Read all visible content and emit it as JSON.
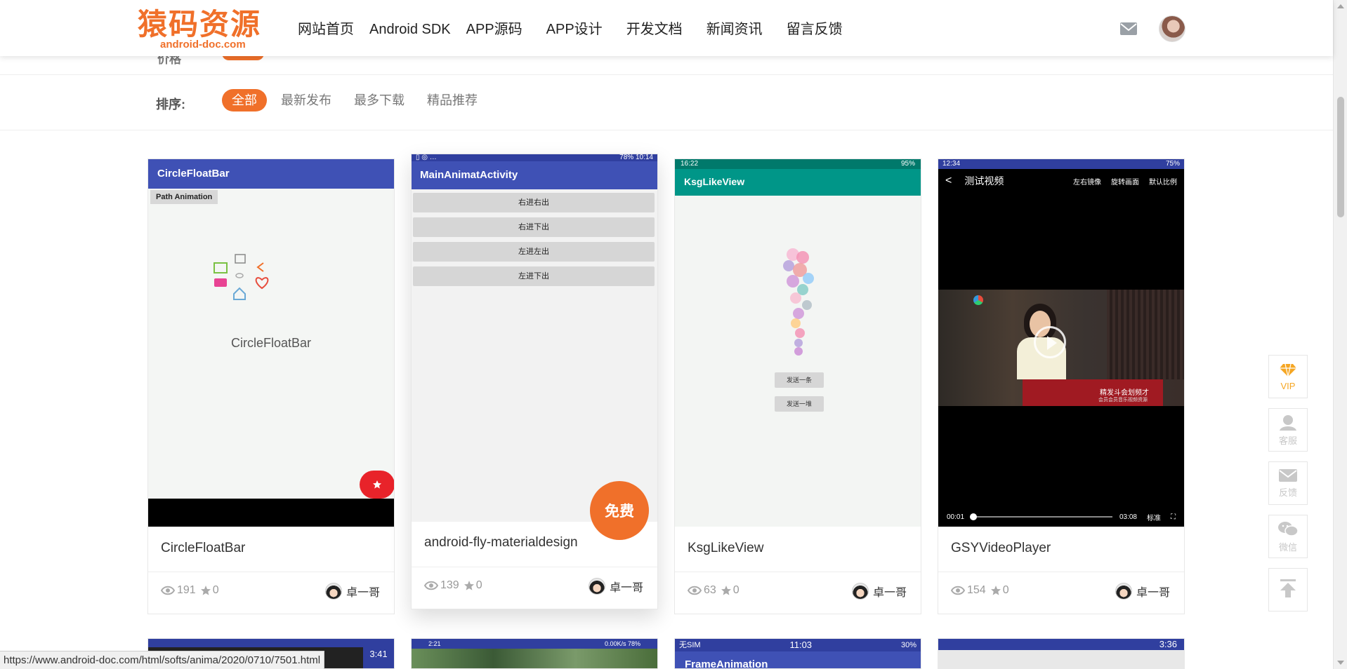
{
  "header": {
    "logo_main": "猿码资源",
    "logo_sub": "android-doc.com",
    "nav": [
      "网站首页",
      "Android SDK",
      "APP源码",
      "APP设计",
      "开发文档",
      "新闻资讯",
      "留言反馈"
    ]
  },
  "filter_remnant": "价格",
  "sort": {
    "label": "排序:",
    "options": [
      "全部",
      "最新发布",
      "最多下载",
      "精品推荐"
    ],
    "active": "全部"
  },
  "cards": [
    {
      "title": "CircleFloatBar",
      "views": "191",
      "stars": "0",
      "author": "卓一哥",
      "thumb": {
        "appbar": "CircleFloatBar",
        "button": "Path Animation",
        "center_text": "CircleFloatBar"
      }
    },
    {
      "title": "android-fly-materialdesign",
      "views": "139",
      "stars": "0",
      "author": "卓一哥",
      "badge": "免费",
      "thumb": {
        "status_left": "▯ ◎ …",
        "status_right": "78% 10:14",
        "appbar": "MainAnimatActivity",
        "buttons": [
          "右进右出",
          "右进下出",
          "左进左出",
          "左进下出"
        ]
      }
    },
    {
      "title": "KsgLikeView",
      "views": "63",
      "stars": "0",
      "author": "卓一哥",
      "thumb": {
        "status_left": "16:22",
        "status_right": "95%",
        "appbar": "KsgLikeView",
        "buttons": [
          "发送一条",
          "发送一堆"
        ]
      }
    },
    {
      "title": "GSYVideoPlayer",
      "views": "154",
      "stars": "0",
      "author": "卓一哥",
      "thumb": {
        "status_left": "12:34",
        "status_right": "75%",
        "back": "<",
        "title": "测试视频",
        "actions": [
          "左右镜像",
          "旋转画面",
          "默认比例"
        ],
        "time_current": "00:01",
        "time_total": "03:08",
        "quality": "标准",
        "caption1": "精发斗会划频才",
        "caption2": "会员会员音乐视频资源"
      }
    }
  ],
  "peek": [
    {
      "status_right": "3:41"
    },
    {
      "status_left": "2:21",
      "status_right": "0.00K/s 78%"
    },
    {
      "status_left": "无SIM",
      "status_mid": "11:03",
      "status_right": "30%",
      "appbar": "FrameAnimation"
    },
    {
      "status_right": "3:36"
    }
  ],
  "sidebar": [
    "VIP",
    "客服",
    "反馈",
    "微信"
  ],
  "status_url": "https://www.android-doc.com/html/softs/anima/2020/0710/7501.html",
  "colors": {
    "accent": "#f0702a",
    "appbar": "#3f51b5",
    "teal": "#009688"
  }
}
